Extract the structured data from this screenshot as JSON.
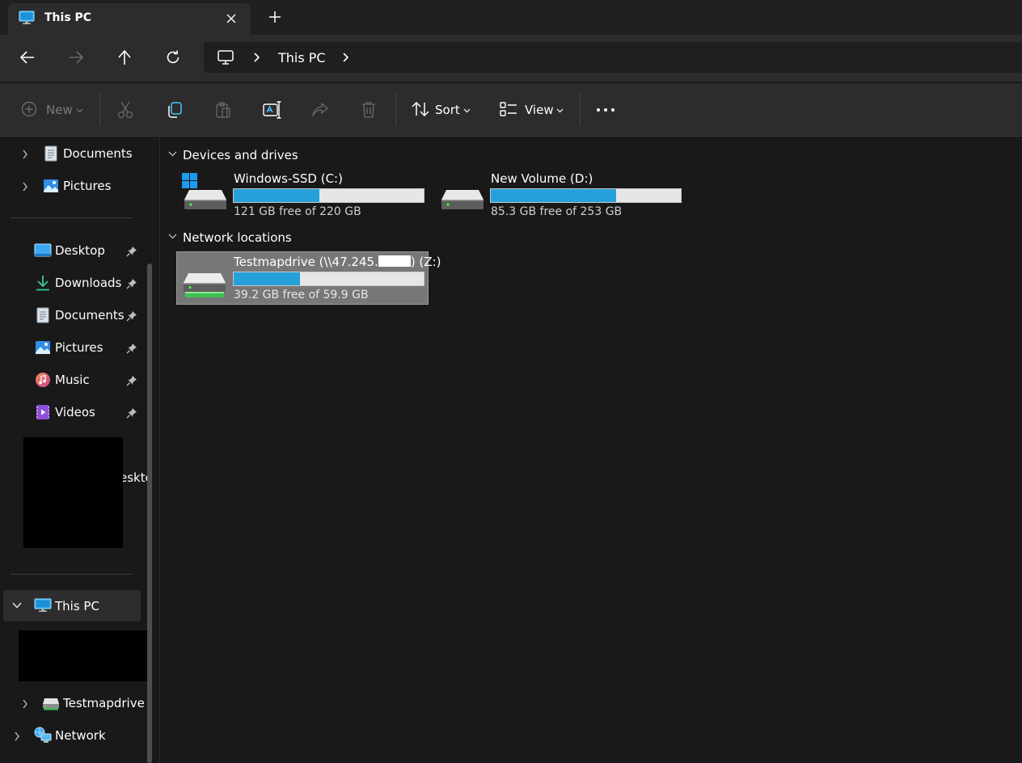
{
  "window": {
    "tab_title": "This PC",
    "new_tab_label": "+"
  },
  "address": {
    "crumb": "This PC"
  },
  "toolbar": {
    "new_label": "New",
    "sort_label": "Sort",
    "view_label": "View"
  },
  "sidebar": {
    "top_items": [
      {
        "label": "Documents",
        "icon": "document-icon"
      },
      {
        "label": "Pictures",
        "icon": "pictures-icon"
      }
    ],
    "quick_access": [
      {
        "label": "Desktop",
        "icon": "desktop-icon",
        "pinned": true
      },
      {
        "label": "Downloads",
        "icon": "download-icon",
        "pinned": true
      },
      {
        "label": "Documents",
        "icon": "document-icon",
        "pinned": true
      },
      {
        "label": "Pictures",
        "icon": "pictures-icon",
        "pinned": true
      },
      {
        "label": "Music",
        "icon": "music-icon",
        "pinned": true
      },
      {
        "label": "Videos",
        "icon": "video-icon",
        "pinned": true
      }
    ],
    "partial_label": "eskto",
    "this_pc_label": "This PC",
    "testmapdrive_label": "Testmapdrive (",
    "network_label": "Network"
  },
  "content": {
    "groups": [
      {
        "title": "Devices and drives",
        "drives": [
          {
            "name": "Windows-SSD (C:)",
            "free_text": "121 GB free of 220 GB",
            "used_fraction": 0.45
          },
          {
            "name": "New Volume (D:)",
            "free_text": "85.3 GB free of 253 GB",
            "used_fraction": 0.66
          }
        ]
      },
      {
        "title": "Network locations",
        "drives": [
          {
            "name_prefix": "Testmapdrive (\\\\47.245.",
            "name_suffix": ") (Z:)",
            "free_text": "39.2 GB free of 59.9 GB",
            "used_fraction": 0.35
          }
        ]
      }
    ]
  },
  "colors": {
    "accent": "#26a0da",
    "selected_tile": "#777777",
    "background": "#191919",
    "chrome": "#2c2c2c"
  }
}
